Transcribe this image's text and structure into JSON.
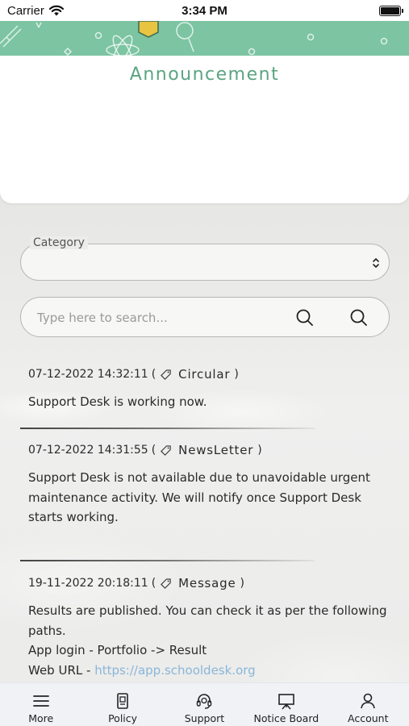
{
  "status_bar": {
    "carrier": "Carrier",
    "time": "3:34 PM"
  },
  "header": {
    "title": "Announcement",
    "banner_color": "#7cc4a2"
  },
  "filter": {
    "category_label": "Category",
    "category_value": ""
  },
  "search": {
    "placeholder": "Type here to search..."
  },
  "announcements": [
    {
      "datetime": "07-12-2022 14:32:11",
      "open_paren": "(",
      "category": "Circular",
      "close_paren": ")",
      "lines": [
        "Support Desk is working now."
      ]
    },
    {
      "datetime": "07-12-2022 14:31:55",
      "open_paren": "(",
      "category": "NewsLetter",
      "close_paren": ")",
      "lines": [
        "Support Desk is not available due to unavoidable urgent",
        "maintenance activity. We will notify once Support Desk",
        "starts working."
      ]
    },
    {
      "datetime": "19-11-2022 20:18:11",
      "open_paren": "(",
      "category": "Message",
      "close_paren": ")",
      "lines": [
        "Results are published. You can check it as per the following",
        "paths.",
        "App login - Portfolio -> Result"
      ],
      "link_prefix": "Web URL - ",
      "link_text": "https://app.schooldesk.org"
    }
  ],
  "bottom_nav": [
    {
      "label": "More",
      "icon": "menu-icon"
    },
    {
      "label": "Policy",
      "icon": "document-icon"
    },
    {
      "label": "Support",
      "icon": "headset-icon"
    },
    {
      "label": "Notice Board",
      "icon": "notice-board-icon"
    },
    {
      "label": "Account",
      "icon": "user-icon"
    }
  ]
}
